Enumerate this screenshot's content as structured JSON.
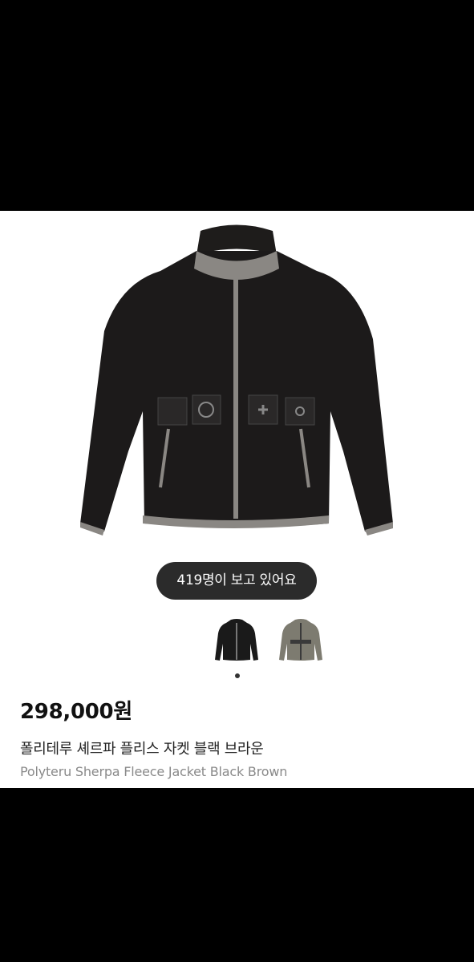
{
  "product": {
    "viewers_text": "419명이 보고 있어요",
    "price": "298,000원",
    "title_ko": "폴리테루 셰르파 플리스 자켓 블랙 브라운",
    "title_en": "Polyteru Sherpa Fleece Jacket Black Brown",
    "variants": [
      {
        "name": "black",
        "color": "#1a1a1a"
      },
      {
        "name": "brown",
        "color": "#7d7b70"
      }
    ],
    "gallery_active_index": 1
  },
  "colors": {
    "jacket_body": "#1c1a1a",
    "trim": "#8a8783",
    "badge_bg": "#2b2b2b"
  }
}
